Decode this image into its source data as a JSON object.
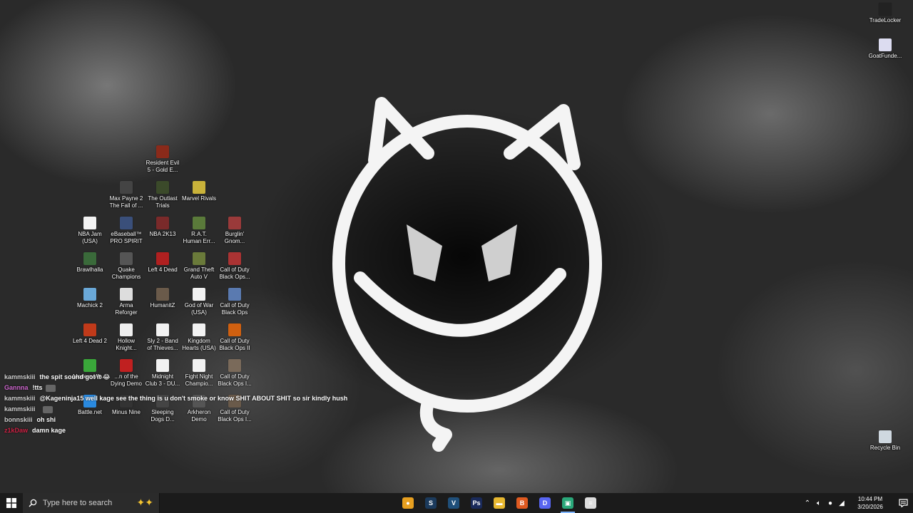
{
  "desktop_icons": [
    {
      "label": "TradeLocker",
      "icon": "tradelocker-icon",
      "color": "#222222"
    },
    {
      "label": "GoatFunde...",
      "icon": "goatfunded-icon",
      "color": "#dcdcf0"
    },
    {
      "label": "Recycle Bin",
      "icon": "recycle-bin-icon",
      "color": "#cfd8e0"
    },
    {
      "label": "Resident Evil\n5 - Gold E...",
      "icon": "resident-evil-icon",
      "color": "#8a2a1a"
    },
    {
      "label": "Max Payne 2\nThe Fall of ...",
      "icon": "max-payne-icon",
      "color": "#444444"
    },
    {
      "label": "The Outlast\nTrials",
      "icon": "outlast-icon",
      "color": "#3b4a2a"
    },
    {
      "label": "Marvel Rivals",
      "icon": "marvel-rivals-icon",
      "color": "#c9b23a"
    },
    {
      "label": "NBA Jam\n(USA)",
      "icon": "file-icon",
      "color": "#f2f2f2"
    },
    {
      "label": "eBaseball™\nPRO SPIRIT",
      "icon": "ebaseball-icon",
      "color": "#3a4f7a"
    },
    {
      "label": "NBA 2K13",
      "icon": "nba2k13-icon",
      "color": "#7a2a2a"
    },
    {
      "label": "R.A.T.\nHuman Err...",
      "icon": "rat-icon",
      "color": "#5a7a3a"
    },
    {
      "label": "Burglin'\nGnom...",
      "icon": "burglin-gnomes-icon",
      "color": "#9a3a3a"
    },
    {
      "label": "Brawlhalla",
      "icon": "brawlhalla-icon",
      "color": "#3a6a3a"
    },
    {
      "label": "Quake\nChampions",
      "icon": "quake-icon",
      "color": "#555555"
    },
    {
      "label": "Left 4 Dead",
      "icon": "left4dead-icon",
      "color": "#b02020"
    },
    {
      "label": "Grand Theft\nAuto V",
      "icon": "gta-v-icon",
      "color": "#6a7a3a"
    },
    {
      "label": "Call of Duty\nBlack Ops...",
      "icon": "cod-black-ops-icon",
      "color": "#aa3333"
    },
    {
      "label": "Machick 2",
      "icon": "machick-icon",
      "color": "#6aa8d8"
    },
    {
      "label": "Arma\nReforger",
      "icon": "arma-icon",
      "color": "#dddddd"
    },
    {
      "label": "HumanitZ",
      "icon": "humanitz-icon",
      "color": "#6a5a4a"
    },
    {
      "label": "God of War\n(USA)",
      "icon": "file-icon",
      "color": "#f2f2f2"
    },
    {
      "label": "Call of Duty\nBlack Ops",
      "icon": "cod-black-ops-icon",
      "color": "#5a7ab0"
    },
    {
      "label": "Left 4 Dead 2",
      "icon": "left4dead2-icon",
      "color": "#c03a1a"
    },
    {
      "label": "Hollow\nKnight...",
      "icon": "hollow-knight-icon",
      "color": "#eeeeee"
    },
    {
      "label": "Sly 2 - Band\nof Thieves...",
      "icon": "file-icon",
      "color": "#f2f2f2"
    },
    {
      "label": "Kingdom\nHearts (USA)",
      "icon": "file-icon",
      "color": "#f2f2f2"
    },
    {
      "label": "Call of Duty\nBlack Ops II",
      "icon": "cod-black-ops-2-icon",
      "color": "#d06010"
    },
    {
      "label": "Modern Wa...",
      "icon": "modern-warfare-icon",
      "color": "#3aa83a"
    },
    {
      "label": "...n of the\nDying Demo",
      "icon": "dying-demo-icon",
      "color": "#c02020"
    },
    {
      "label": "Midnight\nClub 3 - DU...",
      "icon": "file-icon",
      "color": "#f2f2f2"
    },
    {
      "label": "Fight Night\nChampio...",
      "icon": "file-icon",
      "color": "#f2f2f2"
    },
    {
      "label": "Call of Duty\nBlack Ops I...",
      "icon": "cod-black-ops-icon",
      "color": "#7a6a5a"
    },
    {
      "label": "Battle.net",
      "icon": "battlenet-icon",
      "color": "#2a8ae0"
    },
    {
      "label": "Minus Nine",
      "icon": "minus-nine-icon",
      "color": "#333333"
    },
    {
      "label": "Sleeping\nDogs D...",
      "icon": "sleeping-dogs-icon",
      "color": "#444444"
    },
    {
      "label": "Arkheron\nDemo",
      "icon": "arkheron-icon",
      "color": "#555555"
    },
    {
      "label": "Call of Duty\nBlack Ops I...",
      "icon": "cod-black-ops-icon",
      "color": "#6a5a4a"
    }
  ],
  "chat": [
    {
      "user": "kammskiii",
      "color": "#d0d0d0",
      "text": "the spit sound got it 😂"
    },
    {
      "user": "Gannna",
      "color": "#cc66cc",
      "text": "!tts"
    },
    {
      "user": "kammskiii",
      "color": "#d0d0d0",
      "text": "@Kageninja15 well kage see the thing is u don't smoke or know SHIT ABOUT SHIT so sir kindly hush"
    },
    {
      "user": "kammskiii",
      "color": "#d0d0d0",
      "text": ""
    },
    {
      "user": "bonnskiii",
      "color": "#d0d0d0",
      "text": "oh shi"
    },
    {
      "user": "z1kDaw",
      "color": "#cc2244",
      "text": "damn kage"
    }
  ],
  "taskbar": {
    "search_placeholder": "Type here to search",
    "apps": [
      {
        "icon": "chrome-icon",
        "glyph": "●",
        "color": "#e8a020",
        "active": false
      },
      {
        "icon": "steam-icon",
        "glyph": "S",
        "color": "#1b3a5c",
        "active": false
      },
      {
        "icon": "vegas-icon",
        "glyph": "V",
        "color": "#1f4f7a",
        "active": false
      },
      {
        "icon": "photoshop-icon",
        "glyph": "Ps",
        "color": "#1a2a5a",
        "active": false
      },
      {
        "icon": "file-explorer-icon",
        "glyph": "▬",
        "color": "#e8b830",
        "active": false
      },
      {
        "icon": "brave-icon",
        "glyph": "B",
        "color": "#e05a20",
        "active": false
      },
      {
        "icon": "discord-icon",
        "glyph": "D",
        "color": "#5865f2",
        "active": false
      },
      {
        "icon": "chat-app-icon",
        "glyph": "▣",
        "color": "#2aa87a",
        "active": true
      },
      {
        "icon": "notepad-icon",
        "glyph": "≡",
        "color": "#dddddd",
        "active": false
      }
    ],
    "time": "10:44 PM",
    "date": "3/20/2026"
  }
}
